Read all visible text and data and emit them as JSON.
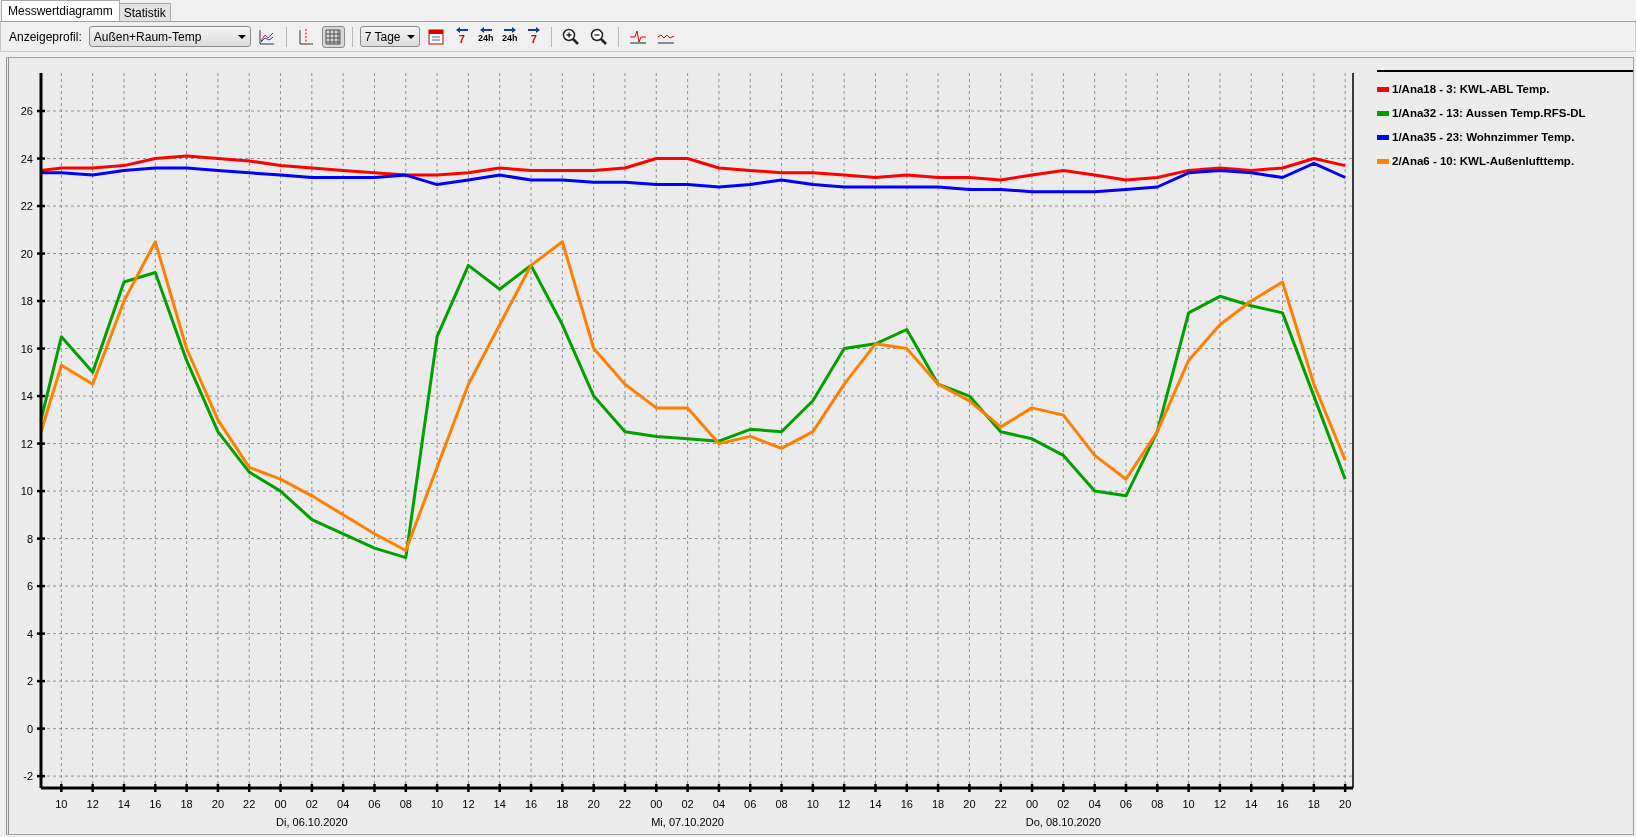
{
  "tabs": [
    {
      "label": "Messwertdiagramm",
      "selected": true
    },
    {
      "label": "Statistik",
      "selected": false
    }
  ],
  "toolbar": {
    "profile_label": "Anzeigeprofil:",
    "profile_value": "Außen+Raum-Temp",
    "grid_toggle": {
      "selected": true
    },
    "range_value": "7 Tage",
    "nav_buttons": [
      {
        "kind": "back",
        "label": "7"
      },
      {
        "kind": "back",
        "label": "24h"
      },
      {
        "kind": "forward",
        "label": "24h"
      },
      {
        "kind": "forward",
        "label": "7"
      }
    ]
  },
  "chart": {
    "chart_data": {
      "type": "line",
      "x": [
        8.7,
        10,
        12,
        14,
        16,
        18,
        20,
        22,
        24,
        26,
        28,
        30,
        32,
        34,
        36,
        38,
        40,
        42,
        44,
        46,
        48,
        50,
        52,
        54,
        56,
        58,
        60,
        62,
        64,
        66,
        68,
        70,
        72,
        74,
        76,
        78,
        80,
        82,
        84,
        86,
        88,
        90,
        92
      ],
      "series": [
        {
          "name": "1/Ana18 - 3: KWL-ABL Temp.",
          "color": "#ff0000",
          "values": [
            23.5,
            23.6,
            23.6,
            23.7,
            24,
            24.1,
            24,
            23.9,
            23.7,
            23.6,
            23.5,
            23.4,
            23.3,
            23.3,
            23.4,
            23.6,
            23.5,
            23.5,
            23.5,
            23.6,
            24,
            24,
            23.6,
            23.5,
            23.4,
            23.4,
            23.3,
            23.2,
            23.3,
            23.2,
            23.2,
            23.1,
            23.3,
            23.5,
            23.3,
            23.1,
            23.2,
            23.5,
            23.6,
            23.5,
            23.6,
            24,
            23.7
          ]
        },
        {
          "name": "1/Ana32 - 13: Aussen Temp.RFS-DL",
          "color": "#00a000",
          "values": [
            13,
            16.5,
            15,
            18.8,
            19.2,
            15.5,
            12.5,
            10.8,
            10,
            8.8,
            8.2,
            7.6,
            7.2,
            16.5,
            19.5,
            18.5,
            19.5,
            17,
            14,
            12.5,
            12.3,
            12.2,
            12.1,
            12.6,
            12.5,
            13.8,
            16,
            16.2,
            16.8,
            14.5,
            14,
            12.5,
            12.2,
            11.5,
            10,
            9.8,
            12.5,
            17.5,
            18.2,
            17.8,
            17.5,
            14,
            10.5
          ]
        },
        {
          "name": "1/Ana35 - 23: Wohnzimmer Temp.",
          "color": "#0000ff",
          "values": [
            23.4,
            23.4,
            23.3,
            23.5,
            23.6,
            23.6,
            23.5,
            23.4,
            23.3,
            23.2,
            23.2,
            23.2,
            23.3,
            22.9,
            23.1,
            23.3,
            23.1,
            23.1,
            23,
            23,
            22.9,
            22.9,
            22.8,
            22.9,
            23.1,
            22.9,
            22.8,
            22.8,
            22.8,
            22.8,
            22.7,
            22.7,
            22.6,
            22.6,
            22.6,
            22.7,
            22.8,
            23.4,
            23.5,
            23.4,
            23.2,
            23.8,
            23.2
          ]
        },
        {
          "name": "2/Ana6 - 10: KWL-Außenlufttemp.",
          "color": "#ff8000",
          "values": [
            12.5,
            15.3,
            14.5,
            18,
            20.5,
            16,
            13,
            11,
            10.5,
            9.8,
            9,
            8.2,
            7.5,
            11,
            14.5,
            17,
            19.5,
            20.5,
            16,
            14.5,
            13.5,
            13.5,
            12,
            12.3,
            11.8,
            12.5,
            14.5,
            16.2,
            16,
            14.5,
            13.8,
            12.7,
            13.5,
            13.2,
            11.5,
            10.5,
            12.5,
            15.5,
            17,
            18,
            18.8,
            14.5,
            11.3
          ]
        }
      ],
      "xlim": [
        8.7,
        92.5
      ],
      "ylim": [
        -2.5,
        27.6
      ],
      "xticks": [
        {
          "value": 10,
          "label": "10"
        },
        {
          "value": 12,
          "label": "12"
        },
        {
          "value": 14,
          "label": "14"
        },
        {
          "value": 16,
          "label": "16"
        },
        {
          "value": 18,
          "label": "18"
        },
        {
          "value": 20,
          "label": "20"
        },
        {
          "value": 22,
          "label": "22"
        },
        {
          "value": 24,
          "label": "00"
        },
        {
          "value": 26,
          "label": "02"
        },
        {
          "value": 28,
          "label": "04"
        },
        {
          "value": 30,
          "label": "06"
        },
        {
          "value": 32,
          "label": "08"
        },
        {
          "value": 34,
          "label": "10"
        },
        {
          "value": 36,
          "label": "12"
        },
        {
          "value": 38,
          "label": "14"
        },
        {
          "value": 40,
          "label": "16"
        },
        {
          "value": 42,
          "label": "18"
        },
        {
          "value": 44,
          "label": "20"
        },
        {
          "value": 46,
          "label": "22"
        },
        {
          "value": 48,
          "label": "00"
        },
        {
          "value": 50,
          "label": "02"
        },
        {
          "value": 52,
          "label": "04"
        },
        {
          "value": 54,
          "label": "06"
        },
        {
          "value": 56,
          "label": "08"
        },
        {
          "value": 58,
          "label": "10"
        },
        {
          "value": 60,
          "label": "12"
        },
        {
          "value": 62,
          "label": "14"
        },
        {
          "value": 64,
          "label": "16"
        },
        {
          "value": 66,
          "label": "18"
        },
        {
          "value": 68,
          "label": "20"
        },
        {
          "value": 70,
          "label": "22"
        },
        {
          "value": 72,
          "label": "00"
        },
        {
          "value": 74,
          "label": "02"
        },
        {
          "value": 76,
          "label": "04"
        },
        {
          "value": 78,
          "label": "06"
        },
        {
          "value": 80,
          "label": "08"
        },
        {
          "value": 82,
          "label": "10"
        },
        {
          "value": 84,
          "label": "12"
        },
        {
          "value": 86,
          "label": "14"
        },
        {
          "value": 88,
          "label": "16"
        },
        {
          "value": 90,
          "label": "18"
        },
        {
          "value": 92,
          "label": "20"
        }
      ],
      "yticks": [
        -2,
        0,
        2,
        4,
        6,
        8,
        10,
        12,
        14,
        16,
        18,
        20,
        22,
        24,
        26
      ],
      "grid": true,
      "annotations": [
        "Di, 06.10.2020",
        "Mi, 07.10.2020",
        "Do, 08.10.2020"
      ]
    }
  }
}
